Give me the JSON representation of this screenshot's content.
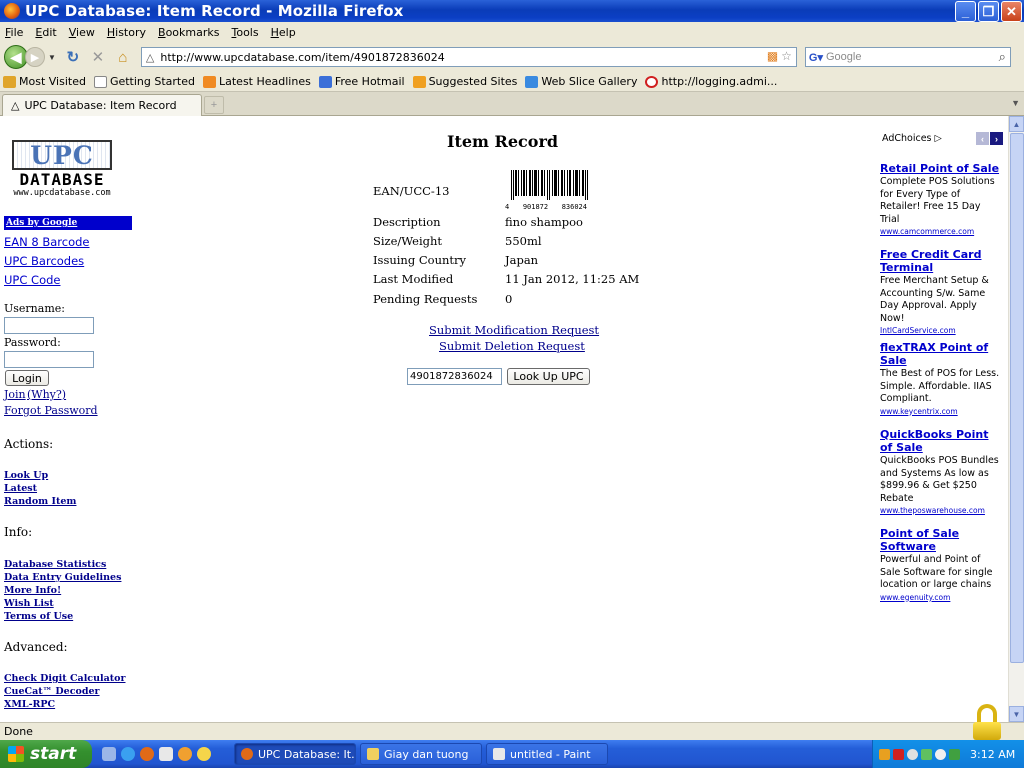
{
  "window": {
    "title": "UPC Database: Item Record - Mozilla Firefox"
  },
  "menu": [
    "File",
    "Edit",
    "View",
    "History",
    "Bookmarks",
    "Tools",
    "Help"
  ],
  "navbar": {
    "url": "http://www.upcdatabase.com/item/4901872836024",
    "search_placeholder": "Google"
  },
  "bookmarks": [
    {
      "label": "Most Visited",
      "icon": "star-icon",
      "color": "#e0a52a"
    },
    {
      "label": "Getting Started",
      "icon": "page-icon",
      "color": "#ffffff"
    },
    {
      "label": "Latest Headlines",
      "icon": "rss-icon",
      "color": "#f08a22"
    },
    {
      "label": "Free Hotmail",
      "icon": "msn-icon",
      "color": "#3b6fd8"
    },
    {
      "label": "Suggested Sites",
      "icon": "suggested-icon",
      "color": "#f0a020"
    },
    {
      "label": "Web Slice Gallery",
      "icon": "slice-icon",
      "color": "#3a8ae0"
    },
    {
      "label": "http://logging.admi...",
      "icon": "toyota-icon",
      "color": "#d02020"
    }
  ],
  "tab": {
    "label": "UPC Database: Item Record"
  },
  "left": {
    "logo_upc": "UPC",
    "logo_database": "DATABASE",
    "logo_www": "www.upcdatabase.com",
    "ads_by_google": "Ads by Google",
    "ad_links": [
      "EAN 8 Barcode",
      "UPC Barcodes",
      "UPC Code"
    ],
    "username_label": "Username:",
    "password_label": "Password:",
    "login_button": "Login",
    "join": "Join",
    "why": "(Why?)",
    "forgot_password": "Forgot Password",
    "actions_heading": "Actions:",
    "actions": [
      "Look Up",
      "Latest",
      "Random Item"
    ],
    "info_heading": "Info:",
    "info": [
      "Database Statistics",
      "Data Entry Guidelines",
      "More Info!",
      "Wish List",
      "Terms of Use"
    ],
    "advanced_heading": "Advanced:",
    "advanced": [
      "Check Digit Calculator",
      "CueCat™ Decoder",
      "XML-RPC"
    ]
  },
  "record": {
    "title": "Item Record",
    "rows": [
      {
        "label": "EAN/UCC-13",
        "value": ""
      },
      {
        "label": "Description",
        "value": "fino shampoo"
      },
      {
        "label": "Size/Weight",
        "value": "550ml"
      },
      {
        "label": "Issuing Country",
        "value": "Japan"
      },
      {
        "label": "Last Modified",
        "value": "11 Jan 2012, 11:25 AM"
      },
      {
        "label": "Pending Requests",
        "value": "0"
      }
    ],
    "barcode_digits": [
      "4",
      "901872",
      "836024"
    ],
    "submit_modification": "Submit Modification Request",
    "submit_deletion": "Submit Deletion Request",
    "lookup_value": "4901872836024",
    "lookup_button": "Look Up UPC"
  },
  "ads": {
    "adchoices": "AdChoices",
    "items": [
      {
        "title": "Retail Point of Sale",
        "body": "Complete POS Solutions for Every Type of Retailer! Free 15 Day Trial",
        "url": "www.camcommerce.com"
      },
      {
        "title": "Free Credit Card Terminal",
        "body": "Free Merchant Setup & Accounting S/w. Same Day Approval. Apply Now!",
        "url": "IntlCardService.com"
      },
      {
        "title": "flexTRAX Point of Sale",
        "body": "The Best of POS for Less. Simple. Affordable. IIAS Compliant.",
        "url": "www.keycentrix.com"
      },
      {
        "title": "QuickBooks Point of Sale",
        "body": "QuickBooks POS Bundles and Systems As low as $899.96 & Get $250 Rebate",
        "url": "www.theposwarehouse.com"
      },
      {
        "title": "Point of Sale Software",
        "body": "Powerful and Point of Sale Software for single location or large chains",
        "url": "www.egenuity.com"
      }
    ]
  },
  "status": {
    "text": "Done"
  },
  "taskbar": {
    "start": "start",
    "items": [
      {
        "label": "UPC Database: It...",
        "icon_color": "#e06a18",
        "active": true
      },
      {
        "label": "Giay dan tuong",
        "icon_color": "#f0d060",
        "active": false
      },
      {
        "label": "untitled - Paint",
        "icon_color": "#e8e8e8",
        "active": false
      }
    ],
    "clock": "3:12 AM"
  }
}
